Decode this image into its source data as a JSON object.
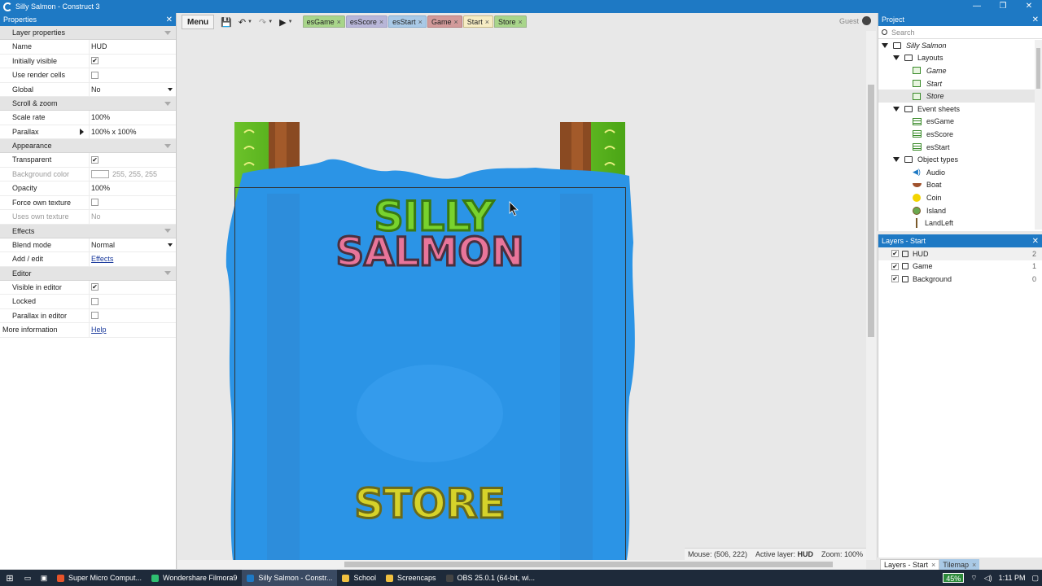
{
  "window": {
    "title": "Silly Salmon - Construct 3",
    "controls": [
      "—",
      "❐",
      "✕"
    ]
  },
  "properties": {
    "header": "Properties",
    "sections": [
      {
        "title": "Layer properties",
        "rows": [
          {
            "key": "Name",
            "value": "HUD",
            "type": "text"
          },
          {
            "key": "Initially visible",
            "checked": true,
            "type": "check"
          },
          {
            "key": "Use render cells",
            "checked": false,
            "type": "check"
          },
          {
            "key": "Global",
            "value": "No",
            "type": "select"
          }
        ]
      },
      {
        "title": "Scroll & zoom",
        "rows": [
          {
            "key": "Scale rate",
            "value": "100%",
            "type": "text"
          },
          {
            "key": "Parallax",
            "value": "100% x 100%",
            "type": "expand"
          }
        ]
      },
      {
        "title": "Appearance",
        "rows": [
          {
            "key": "Transparent",
            "checked": true,
            "type": "check"
          },
          {
            "key": "Background color",
            "value": "255, 255, 255",
            "type": "color",
            "dim": true,
            "color": "#ffffff"
          },
          {
            "key": "Opacity",
            "value": "100%",
            "type": "text"
          },
          {
            "key": "Force own texture",
            "checked": false,
            "type": "check"
          },
          {
            "key": "Uses own texture",
            "value": "No",
            "type": "text",
            "dim": true
          }
        ]
      },
      {
        "title": "Effects",
        "rows": [
          {
            "key": "Blend mode",
            "value": "Normal",
            "type": "select"
          },
          {
            "key": "Add / edit",
            "value": "Effects",
            "type": "link"
          }
        ]
      },
      {
        "title": "Editor",
        "rows": [
          {
            "key": "Visible in editor",
            "checked": true,
            "type": "check"
          },
          {
            "key": "Locked",
            "checked": false,
            "type": "check"
          },
          {
            "key": "Parallax in editor",
            "checked": false,
            "type": "check"
          }
        ]
      }
    ],
    "more_info": {
      "key": "More information",
      "value": "Help"
    }
  },
  "toolbar": {
    "menu_label": "Menu",
    "tabs": [
      {
        "label": "esGame",
        "style": "green"
      },
      {
        "label": "esScore",
        "style": "purple"
      },
      {
        "label": "esStart",
        "style": "blue"
      },
      {
        "label": "Game",
        "style": "red"
      },
      {
        "label": "Start",
        "style": "active"
      },
      {
        "label": "Store",
        "style": "green"
      }
    ],
    "tab_close": "×",
    "user": "Guest"
  },
  "canvas": {
    "logo_line1": "SILLY",
    "logo_line2": "SALMON",
    "store_label": "STORE"
  },
  "status": {
    "mouse": "Mouse: (506, 222)",
    "active_layer_label": "Active layer:",
    "active_layer": "HUD",
    "zoom": "Zoom: 100%"
  },
  "project": {
    "header": "Project",
    "search_placeholder": "Search",
    "root": "Silly Salmon",
    "layouts_label": "Layouts",
    "layouts": [
      "Game",
      "Start",
      "Store"
    ],
    "sheets_label": "Event sheets",
    "sheets": [
      "esGame",
      "esScore",
      "esStart"
    ],
    "objects_label": "Object types",
    "objects": [
      {
        "name": "Audio",
        "icon": "audio"
      },
      {
        "name": "Boat",
        "icon": "boat"
      },
      {
        "name": "Coin",
        "icon": "coin"
      },
      {
        "name": "Island",
        "icon": "island"
      },
      {
        "name": "LandLeft",
        "icon": "landleft"
      }
    ]
  },
  "layers": {
    "header": "Layers - Start",
    "items": [
      {
        "name": "HUD",
        "num": "2"
      },
      {
        "name": "Game",
        "num": "1"
      },
      {
        "name": "Background",
        "num": "0"
      }
    ]
  },
  "bottom_tabs": [
    "Layers - Start",
    "Tilemap"
  ],
  "taskbar": {
    "tasks": [
      {
        "label": "Super Micro Comput...",
        "color": "#e8542a"
      },
      {
        "label": "Wondershare Filmora9",
        "color": "#2fbf71"
      },
      {
        "label": "Silly Salmon - Constr...",
        "color": "#1e79c4",
        "active": true
      },
      {
        "label": "School",
        "color": "#f0c040"
      },
      {
        "label": "Screencaps",
        "color": "#f0c040"
      },
      {
        "label": "OBS 25.0.1 (64-bit, wi...",
        "color": "#444444"
      }
    ],
    "battery": "45%",
    "time": "1:11 PM"
  }
}
